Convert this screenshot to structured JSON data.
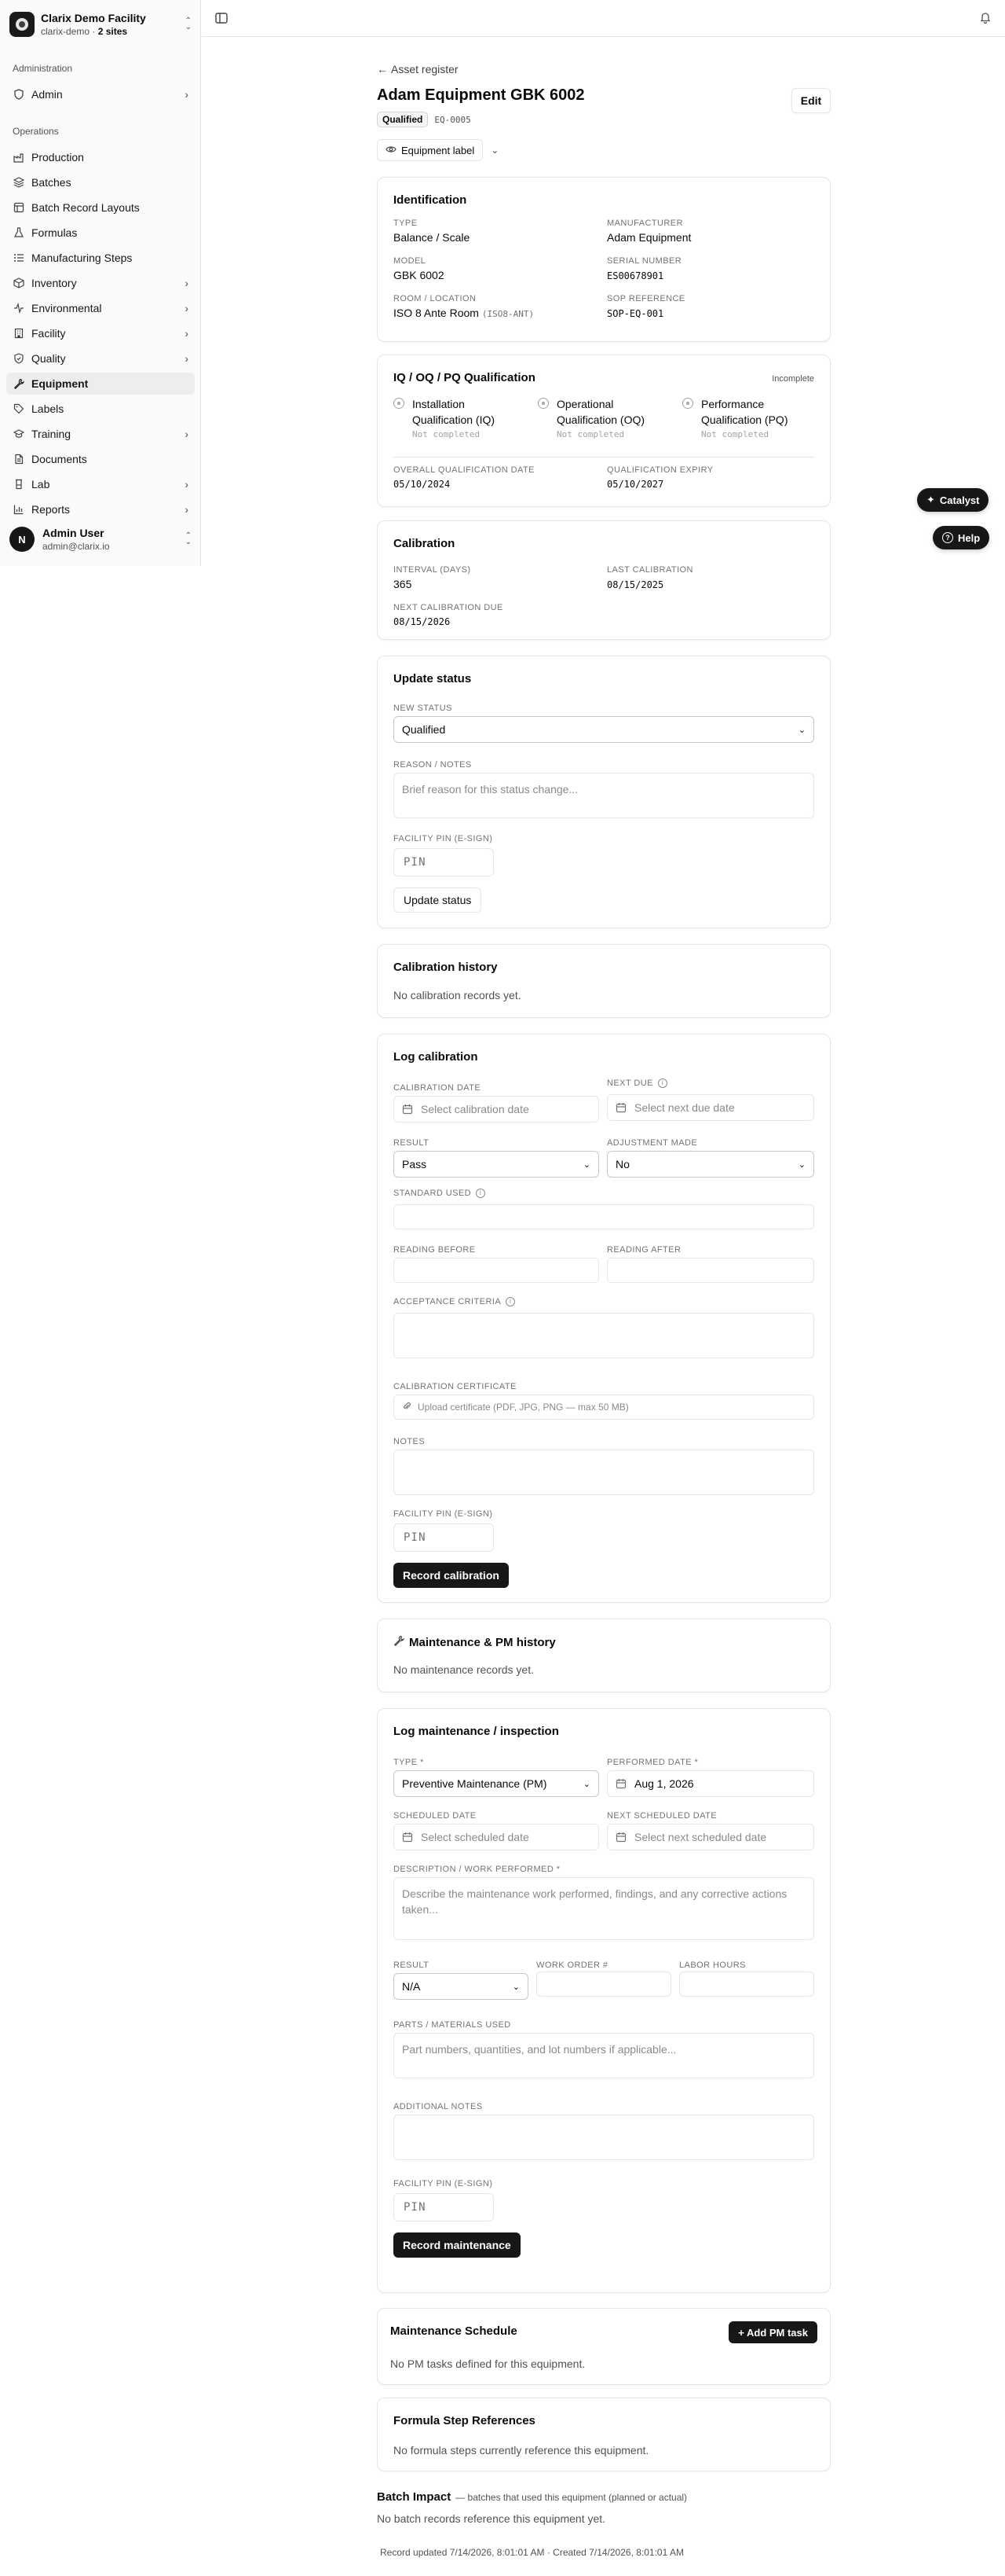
{
  "brand": {
    "name": "Clarix Demo Facility",
    "sub_slug": "clarix-demo",
    "sub_sep": " · ",
    "sub_sites": "2 sites"
  },
  "sidebar": {
    "group_admin": "Administration",
    "admin_item": "Admin",
    "group_ops": "Operations",
    "items": [
      "Production",
      "Batches",
      "Batch Record Layouts",
      "Formulas",
      "Manufacturing Steps",
      "Inventory",
      "Environmental",
      "Facility",
      "Quality",
      "Equipment",
      "Labels",
      "Training",
      "Documents",
      "Lab",
      "Reports"
    ],
    "active": "Equipment"
  },
  "user": {
    "initial": "N",
    "name": "Admin User",
    "email": "admin@clarix.io"
  },
  "header": {
    "back": "Asset register",
    "title": "Adam Equipment GBK 6002",
    "status_badge": "Qualified",
    "code": "EQ-0005",
    "edit": "Edit",
    "label_btn": "Equipment label"
  },
  "identification": {
    "title": "Identification",
    "type_label": "Type",
    "type": "Balance / Scale",
    "manufacturer_label": "Manufacturer",
    "manufacturer": "Adam Equipment",
    "model_label": "Model",
    "model": "GBK 6002",
    "serial_label": "Serial Number",
    "serial": "ES00678901",
    "room_label": "Room / Location",
    "room": "ISO 8 Ante Room",
    "room_code": "(ISO8-ANT)",
    "sop_label": "SOP Reference",
    "sop": "SOP-EQ-001"
  },
  "qualification": {
    "title": "IQ / OQ / PQ Qualification",
    "status": "Incomplete",
    "iq": "Installation Qualification (IQ)",
    "oq": "Operational Qualification (OQ)",
    "pq": "Performance Qualification (PQ)",
    "not_completed": "Not completed",
    "overall_label": "Overall Qualification Date",
    "overall": "05/10/2024",
    "expiry_label": "Qualification Expiry",
    "expiry": "05/10/2027"
  },
  "calibration": {
    "title": "Calibration",
    "interval_label": "Interval (Days)",
    "interval": "365",
    "last_label": "Last Calibration",
    "last": "08/15/2025",
    "next_label": "Next Calibration Due",
    "next": "08/15/2026"
  },
  "update_status": {
    "title": "Update status",
    "new_status_label": "New Status",
    "new_status": "Qualified",
    "reason_label": "Reason / Notes",
    "reason_ph": "Brief reason for this status change...",
    "pin_label": "Facility PIN (E-Sign)",
    "pin_ph": "PIN",
    "button": "Update status"
  },
  "calibration_history": {
    "title": "Calibration history",
    "empty": "No calibration records yet."
  },
  "log_calibration": {
    "title": "Log calibration",
    "date_label": "Calibration Date",
    "date_ph": "Select calibration date",
    "next_label": "Next Due",
    "next_ph": "Select next due date",
    "result_label": "Result",
    "result": "Pass",
    "adjust_label": "Adjustment Made",
    "adjust": "No",
    "standard_label": "Standard Used",
    "before_label": "Reading Before",
    "after_label": "Reading After",
    "acceptance_label": "Acceptance Criteria",
    "cert_label": "Calibration Certificate",
    "cert_ph": "Upload certificate (PDF, JPG, PNG — max 50 MB)",
    "notes_label": "Notes",
    "pin_label": "Facility PIN (E-Sign)",
    "pin_ph": "PIN",
    "button": "Record calibration"
  },
  "maintenance_history": {
    "title": "Maintenance & PM history",
    "empty": "No maintenance records yet."
  },
  "log_maintenance": {
    "title": "Log maintenance / inspection",
    "type_label": "Type *",
    "type": "Preventive Maintenance (PM)",
    "performed_label": "Performed Date *",
    "performed": "Aug 1, 2026",
    "scheduled_label": "Scheduled Date",
    "scheduled_ph": "Select scheduled date",
    "next_label": "Next Scheduled Date",
    "next_ph": "Select next scheduled date",
    "desc_label": "Description / Work Performed *",
    "desc_ph": "Describe the maintenance work performed, findings, and any corrective actions taken...",
    "result_label": "Result",
    "result": "N/A",
    "wo_label": "Work Order #",
    "labor_label": "Labor Hours",
    "parts_label": "Parts / Materials Used",
    "parts_ph": "Part numbers, quantities, and lot numbers if applicable...",
    "notes_label": "Additional Notes",
    "pin_label": "Facility PIN (E-Sign)",
    "pin_ph": "PIN",
    "button": "Record maintenance"
  },
  "schedule": {
    "title": "Maintenance Schedule",
    "add": "+ Add PM task",
    "empty": "No PM tasks defined for this equipment."
  },
  "formula_refs": {
    "title": "Formula Step References",
    "empty": "No formula steps currently reference this equipment."
  },
  "batch_impact": {
    "title": "Batch Impact",
    "sub": "— batches that used this equipment (planned or actual)",
    "empty": "No batch records reference this equipment yet."
  },
  "footer": "Record updated 7/14/2026, 8:01:01 AM · Created 7/14/2026, 8:01:01 AM",
  "floating": {
    "catalyst": "Catalyst",
    "help": "Help"
  }
}
